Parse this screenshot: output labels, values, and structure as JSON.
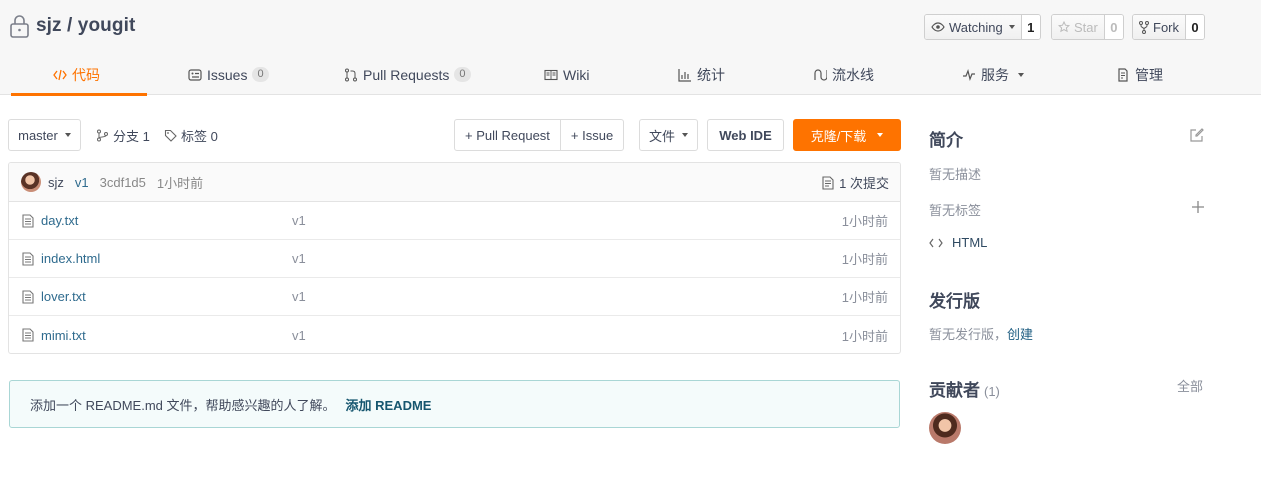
{
  "repo": {
    "name": "sjz / yougit"
  },
  "social": {
    "watch_label": "Watching",
    "watch_count": "1",
    "star_label": "Star",
    "star_count": "0",
    "fork_label": "Fork",
    "fork_count": "0"
  },
  "tabs": [
    {
      "label": "代码",
      "icon": "code-icon",
      "badge": null
    },
    {
      "label": "Issues",
      "icon": "issues-icon",
      "badge": "0"
    },
    {
      "label": "Pull Requests",
      "icon": "pull-request-icon",
      "badge": "0"
    },
    {
      "label": "Wiki",
      "icon": "wiki-book-icon",
      "badge": null
    },
    {
      "label": "统计",
      "icon": "bar-chart-icon",
      "badge": null
    },
    {
      "label": "流水线",
      "icon": "pipeline-icon",
      "badge": null
    },
    {
      "label": "服务",
      "icon": "pulse-icon",
      "badge": null
    },
    {
      "label": "管理",
      "icon": "settings-doc-icon",
      "badge": null
    }
  ],
  "toolbar": {
    "branch": "master",
    "branches": "分支 1",
    "tags": "标签 0",
    "new_pr": "+ Pull Request",
    "new_issue": "+ Issue",
    "file_menu": "文件",
    "web_ide": "Web IDE",
    "clone": "克隆/下载"
  },
  "commit": {
    "author": "sjz",
    "message": "v1",
    "hash": "3cdf1d5",
    "time": "1小时前",
    "count": "1 次提交"
  },
  "files": [
    {
      "name": "day.txt",
      "message": "v1",
      "time": "1小时前"
    },
    {
      "name": "index.html",
      "message": "v1",
      "time": "1小时前"
    },
    {
      "name": "lover.txt",
      "message": "v1",
      "time": "1小时前"
    },
    {
      "name": "mimi.txt",
      "message": "v1",
      "time": "1小时前"
    }
  ],
  "readme": {
    "prompt": "添加一个 README.md 文件，帮助感兴趣的人了解。",
    "action": "添加 README"
  },
  "sidebar": {
    "intro_title": "简介",
    "no_desc": "暂无描述",
    "no_tags": "暂无标签",
    "language": "HTML",
    "release_title": "发行版",
    "no_release": "暂无发行版，",
    "create": "创建",
    "contrib_title": "贡献者",
    "contrib_count": "(1)",
    "all": "全部"
  },
  "colors": {
    "accent": "#fe7300",
    "link": "#2f6b8e",
    "text": "#40485b"
  }
}
